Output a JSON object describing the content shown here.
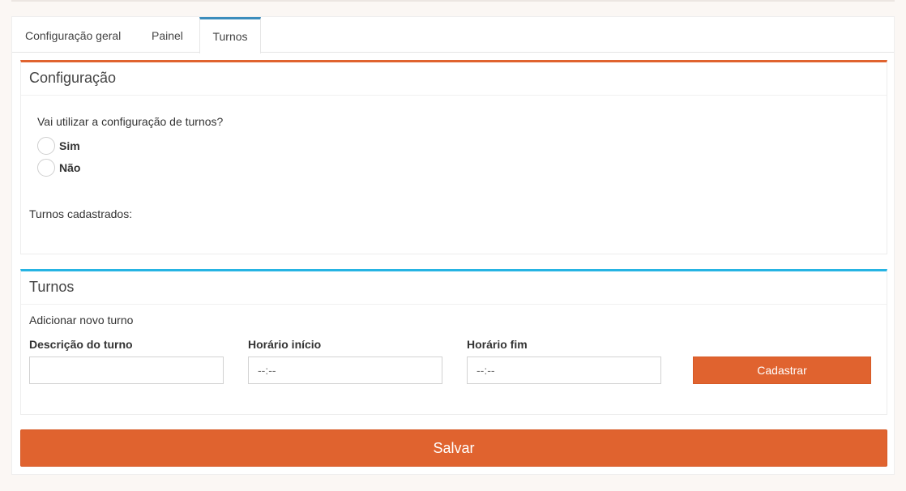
{
  "tabs": [
    {
      "label": "Configuração geral"
    },
    {
      "label": "Painel"
    },
    {
      "label": "Turnos",
      "active": true
    }
  ],
  "config_box": {
    "title": "Configuração",
    "question": "Vai utilizar a configuração de turnos?",
    "options": [
      {
        "label": "Sim",
        "checked": false
      },
      {
        "label": "Não",
        "checked": false
      }
    ],
    "registered_label": "Turnos cadastrados:"
  },
  "turnos_box": {
    "title": "Turnos",
    "add_title": "Adicionar novo turno",
    "description_label": "Descrição do turno",
    "description_value": "",
    "start_label": "Horário início",
    "start_value": "--:--",
    "end_label": "Horário fim",
    "end_value": "--:--",
    "register_button": "Cadastrar"
  },
  "save_button": "Salvar",
  "colors": {
    "accent_orange": "#e0632f",
    "accent_blue": "#26b4e3",
    "active_tab": "#3c8dbc"
  }
}
